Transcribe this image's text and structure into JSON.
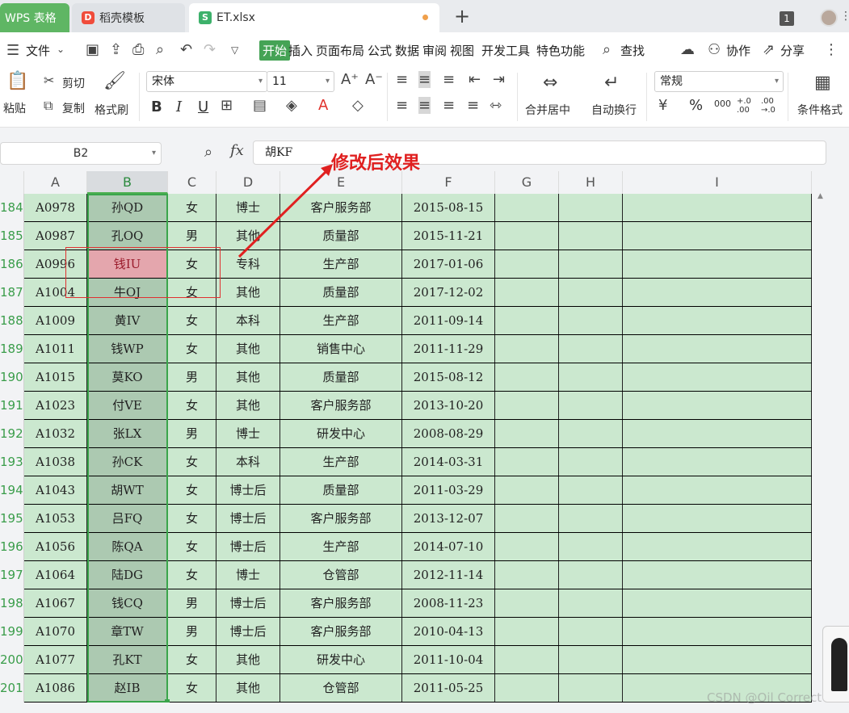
{
  "tabs": {
    "wps": "WPS 表格",
    "daoke": "稻壳模板",
    "file": "ET.xlsx",
    "window_count": "1",
    "new_tab_icon": "plus-icon"
  },
  "menu": {
    "file": "文件",
    "start": "开始",
    "insert": "插入",
    "page_layout": "页面布局",
    "formula": "公式",
    "data": "数据",
    "review": "审阅",
    "view": "视图",
    "dev_tools": "开发工具",
    "special": "特色功能",
    "search": "查找",
    "collab": "协作",
    "share": "分享"
  },
  "ribbon": {
    "paste": "粘贴",
    "cut": "剪切",
    "copy": "复制",
    "format_painter": "格式刷",
    "font_name": "宋体",
    "font_size": "11",
    "merge_center": "合并居中",
    "wrap_text": "自动换行",
    "number_format": "常规",
    "conditional_format": "条件格式",
    "bold": "B",
    "italic": "I",
    "underline": "U",
    "percent": "%",
    "thousands": "000",
    "inc_decimal": "+.0 .00",
    "dec_decimal": ".00 →.0",
    "accent": "#e0312b"
  },
  "formula_bar": {
    "name_box": "B2",
    "fx": "fx",
    "value": "胡KF"
  },
  "columns": [
    "A",
    "B",
    "C",
    "D",
    "E",
    "F",
    "G",
    "H",
    "I"
  ],
  "rows": [
    {
      "n": "184",
      "a": "A0978",
      "b": "孙QD",
      "c": "女",
      "d": "博士",
      "e": "客户服务部",
      "f": "2015-08-15"
    },
    {
      "n": "185",
      "a": "A0987",
      "b": "孔OQ",
      "c": "男",
      "d": "其他",
      "e": "质量部",
      "f": "2015-11-21"
    },
    {
      "n": "186",
      "a": "A0996",
      "b": "钱IU",
      "c": "女",
      "d": "专科",
      "e": "生产部",
      "f": "2017-01-06",
      "highlight": true
    },
    {
      "n": "187",
      "a": "A1004",
      "b": "牛OJ",
      "c": "女",
      "d": "其他",
      "e": "质量部",
      "f": "2017-12-02"
    },
    {
      "n": "188",
      "a": "A1009",
      "b": "黄IV",
      "c": "女",
      "d": "本科",
      "e": "生产部",
      "f": "2011-09-14"
    },
    {
      "n": "189",
      "a": "A1011",
      "b": "钱WP",
      "c": "女",
      "d": "其他",
      "e": "销售中心",
      "f": "2011-11-29"
    },
    {
      "n": "190",
      "a": "A1015",
      "b": "莫KO",
      "c": "男",
      "d": "其他",
      "e": "质量部",
      "f": "2015-08-12"
    },
    {
      "n": "191",
      "a": "A1023",
      "b": "付VE",
      "c": "女",
      "d": "其他",
      "e": "客户服务部",
      "f": "2013-10-20"
    },
    {
      "n": "192",
      "a": "A1032",
      "b": "张LX",
      "c": "男",
      "d": "博士",
      "e": "研发中心",
      "f": "2008-08-29"
    },
    {
      "n": "193",
      "a": "A1038",
      "b": "孙CK",
      "c": "女",
      "d": "本科",
      "e": "生产部",
      "f": "2014-03-31"
    },
    {
      "n": "194",
      "a": "A1043",
      "b": "胡WT",
      "c": "女",
      "d": "博士后",
      "e": "质量部",
      "f": "2011-03-29"
    },
    {
      "n": "195",
      "a": "A1053",
      "b": "吕FQ",
      "c": "女",
      "d": "博士后",
      "e": "客户服务部",
      "f": "2013-12-07"
    },
    {
      "n": "196",
      "a": "A1056",
      "b": "陈QA",
      "c": "女",
      "d": "博士后",
      "e": "生产部",
      "f": "2014-07-10"
    },
    {
      "n": "197",
      "a": "A1064",
      "b": "陆DG",
      "c": "女",
      "d": "博士",
      "e": "仓管部",
      "f": "2012-11-14"
    },
    {
      "n": "198",
      "a": "A1067",
      "b": "钱CQ",
      "c": "男",
      "d": "博士后",
      "e": "客户服务部",
      "f": "2008-11-23"
    },
    {
      "n": "199",
      "a": "A1070",
      "b": "章TW",
      "c": "男",
      "d": "博士后",
      "e": "客户服务部",
      "f": "2010-04-13"
    },
    {
      "n": "200",
      "a": "A1077",
      "b": "孔KT",
      "c": "女",
      "d": "其他",
      "e": "研发中心",
      "f": "2011-10-04"
    },
    {
      "n": "201",
      "a": "A1086",
      "b": "赵IB",
      "c": "女",
      "d": "其他",
      "e": "仓管部",
      "f": "2011-05-25"
    }
  ],
  "annotation": {
    "text": "修改后效果",
    "color": "#e02020"
  },
  "watermark": "CSDN @Oil Correct"
}
